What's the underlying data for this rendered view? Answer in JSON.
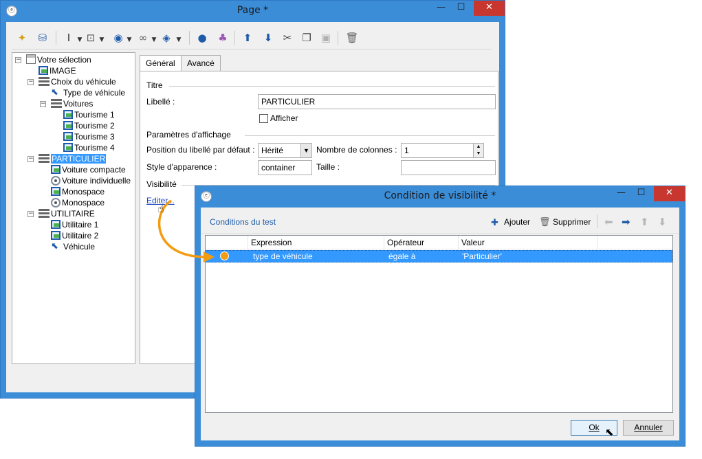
{
  "main_window": {
    "title": "Page *",
    "controls": {
      "minimize": "—",
      "maximize": "☐",
      "close": "✕"
    }
  },
  "tree": {
    "items": [
      {
        "label": "Votre sélection",
        "icon": "table-icon"
      },
      {
        "label": "IMAGE",
        "icon": "image-icon"
      },
      {
        "label": "Choix du véhicule",
        "icon": "list-icon"
      },
      {
        "label": "Type de véhicule",
        "icon": "cursor-icon"
      },
      {
        "label": "Voitures",
        "icon": "list-icon"
      },
      {
        "label": "Tourisme 1",
        "icon": "image-icon"
      },
      {
        "label": "Tourisme 2",
        "icon": "image-icon"
      },
      {
        "label": "Tourisme 3",
        "icon": "image-icon"
      },
      {
        "label": "Tourisme 4",
        "icon": "image-icon"
      },
      {
        "label": "PARTICULIER",
        "icon": "list-icon"
      },
      {
        "label": "Voiture compacte",
        "icon": "image-icon"
      },
      {
        "label": "Voiture individuelle",
        "icon": "radio-icon"
      },
      {
        "label": "Monospace",
        "icon": "image-icon"
      },
      {
        "label": "Monospace",
        "icon": "radio-icon"
      },
      {
        "label": "UTILITAIRE",
        "icon": "list-icon"
      },
      {
        "label": "Utilitaire 1",
        "icon": "image-icon"
      },
      {
        "label": "Utilitaire 2",
        "icon": "image-icon"
      },
      {
        "label": "Véhicule",
        "icon": "cursor-icon"
      }
    ]
  },
  "tabs": {
    "general": "Général",
    "advanced": "Avancé"
  },
  "form": {
    "title_group": "Titre",
    "libelle_label": "Libellé :",
    "libelle_value": "PARTICULIER",
    "afficher_label": "Afficher",
    "display_group": "Paramètres d'affichage",
    "position_label": "Position du libellé par défaut :",
    "position_value": "Hérité",
    "columns_label": "Nombre de colonnes :",
    "columns_value": "1",
    "style_label": "Style d'apparence :",
    "style_value": "container",
    "size_label": "Taille :",
    "size_value": "",
    "visibility_group": "Visibilité",
    "edit_link": "Editer..."
  },
  "dialog": {
    "title": "Condition de visibilité *",
    "section": "Conditions du test",
    "add_label": "Ajouter",
    "delete_label": "Supprimer",
    "columns": [
      "Expression",
      "Opérateur",
      "Valeur"
    ],
    "rows": [
      {
        "expression": "type de véhicule",
        "operator": "égale à",
        "value": "'Particulier'"
      }
    ],
    "ok_label": "Ok",
    "cancel_label": "Annuler"
  },
  "colors": {
    "title_bar": "#3c8dd8",
    "selection": "#3399ff",
    "close_button": "#c7372f",
    "callout_arrow": "#f39c12"
  }
}
